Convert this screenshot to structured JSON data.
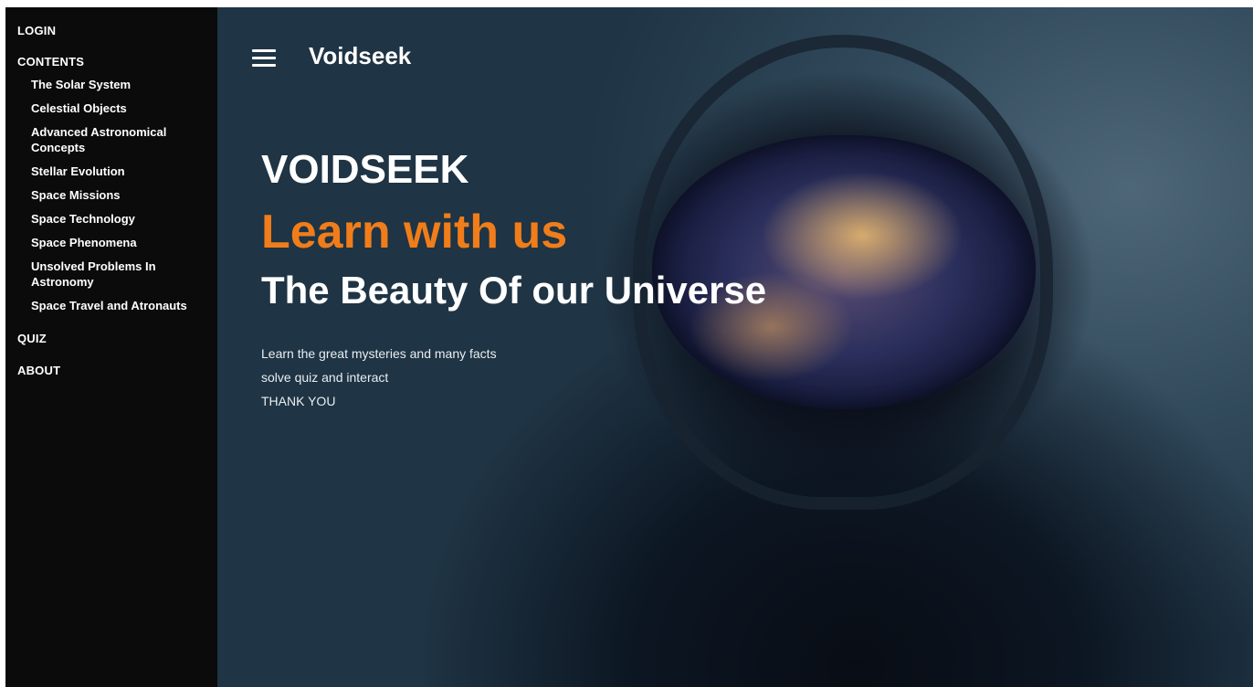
{
  "sidebar": {
    "login": "LOGIN",
    "contents": "CONTENTS",
    "items": [
      "The Solar System",
      "Celestial Objects",
      "Advanced Astronomical Concepts",
      "Stellar Evolution",
      "Space Missions",
      "Space Technology",
      "Space Phenomena",
      "Unsolved Problems In Astronomy",
      "Space Travel and Atronauts"
    ],
    "quiz": "QUIZ",
    "about": "ABOUT"
  },
  "header": {
    "brand": "Voidseek",
    "menu_icon": "hamburger-menu-icon"
  },
  "hero": {
    "title": "VOIDSEEK",
    "tagline": "Learn with us",
    "subtitle": "The Beauty Of our Universe",
    "lines": [
      "Learn the great mysteries and many facts",
      "solve quiz and interact",
      "THANK YOU"
    ],
    "accent_color": "#f07d1a"
  }
}
